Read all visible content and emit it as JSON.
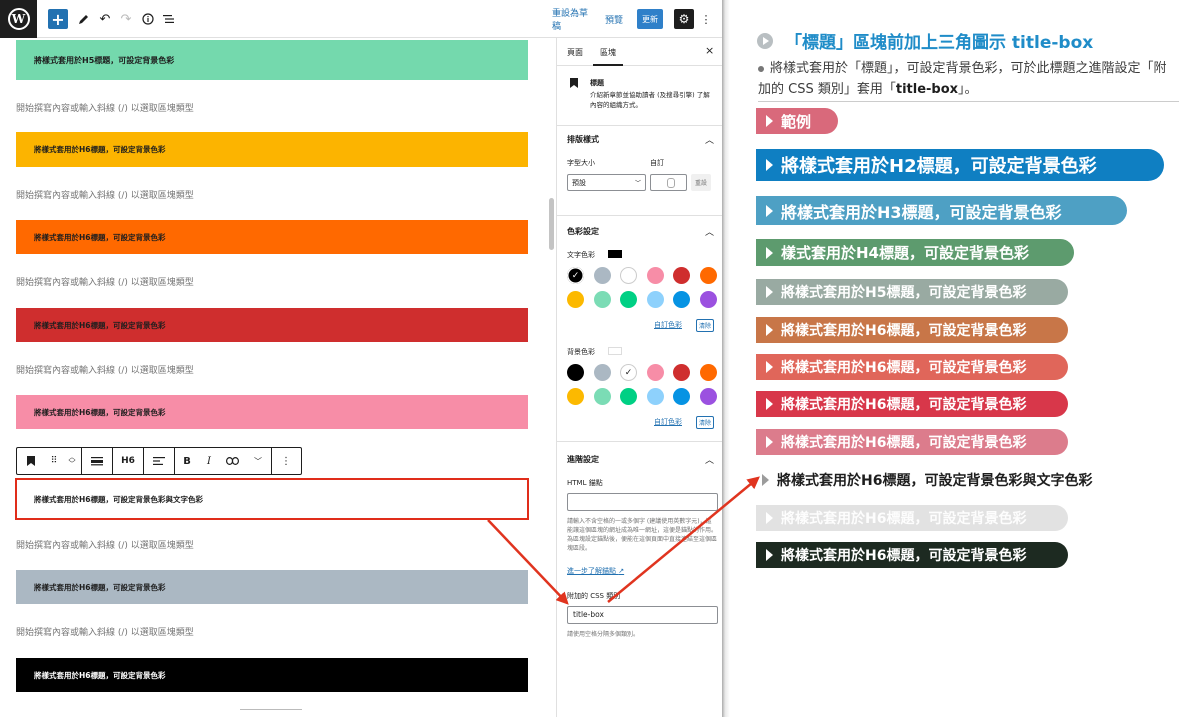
{
  "toolbar": {
    "logo_letter": "W",
    "add_block": "+",
    "save_draft": "重設為草稿",
    "preview": "預覽",
    "update": "更新"
  },
  "canvas": {
    "blocks": [
      {
        "text": "將樣式套用於H5標題，可設定背景色彩",
        "bg": "#74d9ad"
      },
      {
        "text": "將樣式套用於H6標題，可設定背景色彩",
        "bg": "#fcb400"
      },
      {
        "text": "將樣式套用於H6標題，可設定背景色彩",
        "bg": "#ff6900"
      },
      {
        "text": "將樣式套用於H6標題，可設定背景色彩",
        "bg": "#cf2e2e"
      },
      {
        "text": "將樣式套用於H6標題，可設定背景色彩",
        "bg": "#f78da7"
      },
      {
        "text": "將樣式套用於H6標題，可設定背景色彩與文字色彩",
        "bg": "#ffffff"
      },
      {
        "text": "將樣式套用於H6標題，可設定背景色彩",
        "bg": "#abb8c3"
      },
      {
        "text": "將樣式套用於H6標題，可設定背景色彩",
        "bg": "#000000"
      }
    ],
    "placeholder": "開始撰寫內容或輸入斜線 (/) 以選取區塊類型",
    "block_toolbar": {
      "heading_level": "H6",
      "bold": "B",
      "italic": "I"
    }
  },
  "sidebar": {
    "tab_page": "頁面",
    "tab_block": "區塊",
    "close": "×",
    "block_name": "標題",
    "block_desc": "介紹新章節並協助讀者 (及搜尋引擎) 了解內容的組織方式。",
    "typography_title": "排版樣式",
    "font_size_label": "字型大小",
    "custom_label": "自訂",
    "font_size_value": "預設",
    "reset_label": "重設",
    "color_title": "色彩設定",
    "text_color_label": "文字色彩",
    "bg_color_label": "背景色彩",
    "custom_color": "自訂色彩",
    "clear": "清除",
    "palette": [
      "#000000",
      "#abb8c3",
      "#ffffff",
      "#f78da7",
      "#cf2e2e",
      "#ff6900",
      "#fcb900",
      "#7bdcb5",
      "#00d084",
      "#8ed1fc",
      "#0693e3",
      "#9b51e0"
    ],
    "advanced_title": "進階設定",
    "html_anchor_label": "HTML 錨點",
    "anchor_help": "請輸入不含空格的一或多個字 (建議使用英數字元)，這能讓這個區塊的網址成為唯一網址，這便是錨點的作用。為區塊設定錨點後，便能在這個頁面中直接連結至這個區塊區段。",
    "anchor_link": "進一步了解錨點",
    "css_class_label": "附加的 CSS 類別",
    "css_class_value": "title-box",
    "css_help": "請使用空格分隔多個類別。"
  },
  "preview": {
    "heading": "「標題」區塊前加上三角圖示 title-box",
    "desc_part1": "將樣式套用於「標題」，可設定背景色彩，可於此標題之進階設定「附加的 CSS 類別」套用「",
    "desc_bold": "title-box",
    "desc_part2": "」。",
    "pills": [
      {
        "text": "範例",
        "bg": "#d9697b",
        "fs": 15,
        "h": 26,
        "w": 82
      },
      {
        "text": "將樣式套用於H2標題，可設定背景色彩",
        "bg": "#0f7fc2",
        "fs": 18,
        "h": 32,
        "w": 408
      },
      {
        "text": "將樣式套用於H3標題，可設定背景色彩",
        "bg": "#4ea0c4",
        "fs": 16,
        "h": 29,
        "w": 371
      },
      {
        "text": "樣式套用於H4標題，可設定背景色彩",
        "bg": "#5d9b6e",
        "fs": 15,
        "h": 27,
        "w": 318
      },
      {
        "text": "將樣式套用於H5標題，可設定背景色彩",
        "bg": "#99aaa2",
        "fs": 14,
        "h": 26,
        "w": 312
      },
      {
        "text": "將樣式套用於H6標題，可設定背景色彩",
        "bg": "#c87648",
        "fs": 14,
        "h": 26,
        "w": 312
      },
      {
        "text": "將樣式套用於H6標題，可設定背景色彩",
        "bg": "#e0665a",
        "fs": 14,
        "h": 26,
        "w": 312
      },
      {
        "text": "將樣式套用於H6標題，可設定背景色彩",
        "bg": "#d8374a",
        "fs": 14,
        "h": 26,
        "w": 312
      },
      {
        "text": "將樣式套用於H6標題，可設定背景色彩",
        "bg": "#dc7c8c",
        "fs": 14,
        "h": 26,
        "w": 312
      },
      {
        "text": "將樣式套用於H6標題，可設定背景色彩與文字色彩",
        "bg": "#ffffff",
        "fs": 14,
        "h": 26,
        "w": 370
      },
      {
        "text": "將樣式套用於H6標題，可設定背景色彩",
        "bg": "#e2e2e2",
        "fs": 14,
        "h": 26,
        "w": 312
      },
      {
        "text": "將樣式套用於H6標題，可設定背景色彩",
        "bg": "#1d2a21",
        "fs": 14,
        "h": 26,
        "w": 312
      }
    ]
  }
}
